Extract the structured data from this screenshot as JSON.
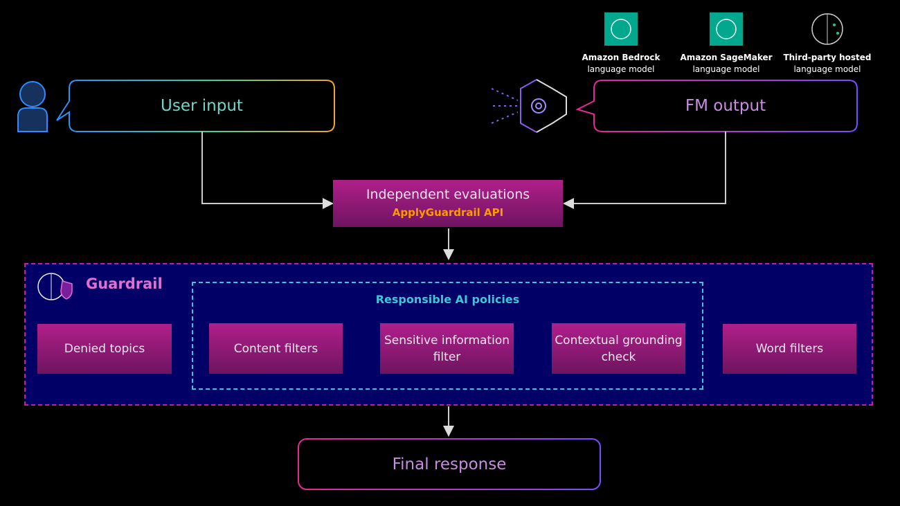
{
  "models": [
    {
      "name": "Amazon Bedrock",
      "sub": "language model",
      "icon": "brain-chip-icon"
    },
    {
      "name": "Amazon SageMaker",
      "sub": "language model",
      "icon": "brain-icon"
    },
    {
      "name": "Third-party hosted",
      "sub": "language model",
      "icon": "brain-outline-icon"
    }
  ],
  "user_input": "User input",
  "fm_output": "FM output",
  "evaluations": {
    "title": "Independent evaluations",
    "api": "ApplyGuardrail API"
  },
  "guardrail": {
    "label": "Guardrail",
    "responsible_title": "Responsible AI policies",
    "denied": "Denied topics",
    "policies": [
      "Content filters",
      "Sensitive information filter",
      "Contextual grounding check"
    ],
    "word": "Word filters"
  },
  "final": "Final response",
  "colors": {
    "magenta": "#b01f8a",
    "navy": "#000066",
    "teal": "#3ec6d6",
    "orange": "#ff9900",
    "pink": "#e070d0"
  }
}
